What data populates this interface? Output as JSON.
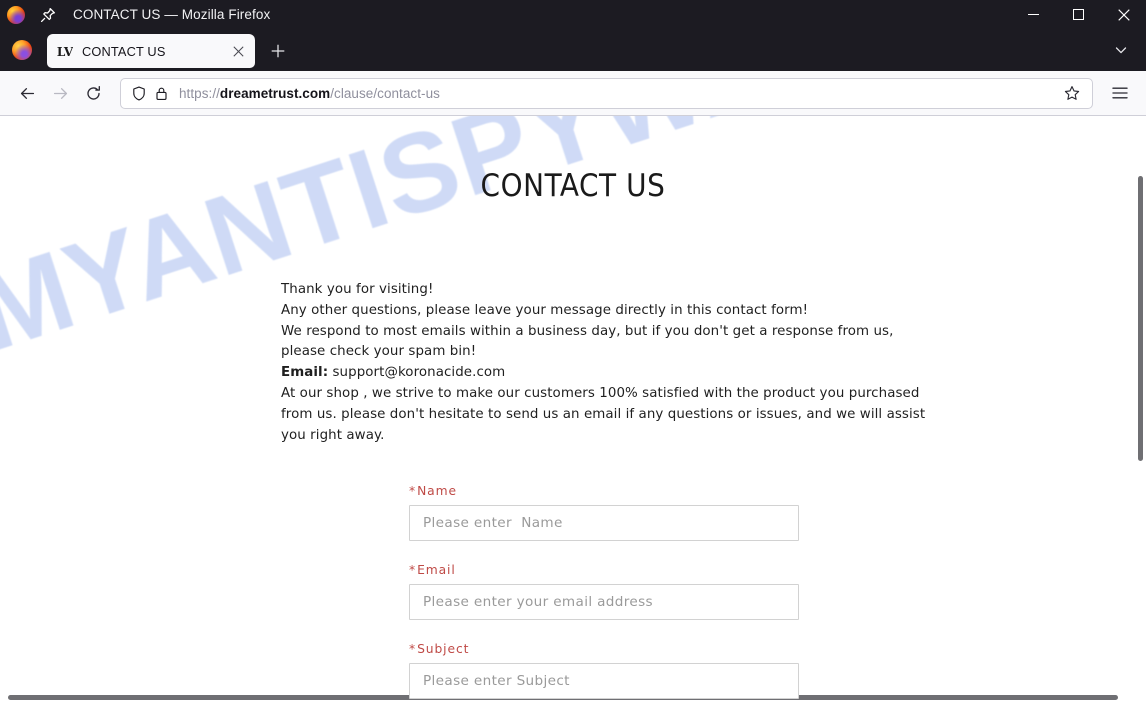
{
  "window": {
    "title": "CONTACT US — Mozilla Firefox",
    "pin_icon": "pin-icon",
    "logo_icon": "firefox-logo",
    "minimize_label": "Minimize",
    "maximize_label": "Maximize",
    "close_label": "Close"
  },
  "tabstrip": {
    "tabs": [
      {
        "title": "CONTACT US",
        "favicon": "lv-monogram-favicon",
        "close_icon": "close-icon"
      }
    ],
    "new_tab_icon": "plus-icon",
    "tab_list_icon": "chevron-down-icon"
  },
  "toolbar": {
    "back_icon": "arrow-left-icon",
    "forward_icon": "arrow-right-icon",
    "reload_icon": "reload-icon",
    "shield_icon": "shield-icon",
    "lock_icon": "lock-icon",
    "bookmark_icon": "star-icon",
    "menu_icon": "hamburger-icon",
    "url": {
      "scheme": "https://",
      "domain": "dreametrust.com",
      "path": "/clause/contact-us",
      "full": "https://dreametrust.com/clause/contact-us"
    }
  },
  "page": {
    "watermark": "MYANTISPYWARE.COM",
    "watermark_color": "#cdd9f6",
    "title": "CONTACT US",
    "paragraph": {
      "line1": "Thank you for visiting!",
      "line2": "Any other questions, please leave your message directly in this contact form!",
      "line3": "We respond to most emails within a business day, but if you don't get a response from us, please check your spam bin!",
      "email_label": "Email:",
      "email_address": "support@koronacide.com",
      "line5": "At our shop , we strive to make our customers 100% satisfied with the product you purchased from us. please don't hesitate to send us an email if any questions or issues, and we will assist you right away."
    },
    "form": {
      "required_marker": "*",
      "label_color": "#bf4a46",
      "fields": [
        {
          "label": "Name",
          "placeholder": "Please enter  Name"
        },
        {
          "label": "Email",
          "placeholder": "Please enter your email address"
        },
        {
          "label": "Subject",
          "placeholder": "Please enter Subject"
        }
      ]
    }
  }
}
